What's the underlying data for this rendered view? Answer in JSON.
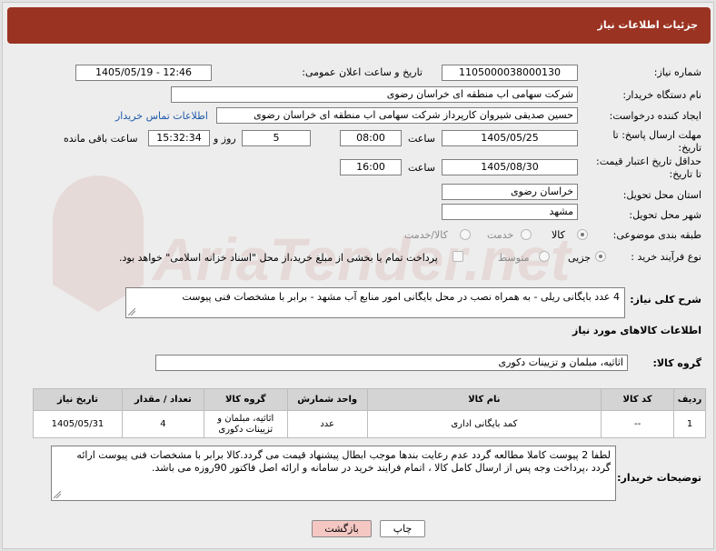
{
  "window": {
    "title": "جزئیات اطلاعات نیاز"
  },
  "form": {
    "need_number": {
      "label": "شماره نیاز:",
      "value": "1105000038000130"
    },
    "announce_datetime": {
      "label": "تاریخ و ساعت اعلان عمومی:",
      "value": "1405/05/19 - 12:46"
    },
    "buyer_org": {
      "label": "نام دستگاه خریدار:",
      "value": "شرکت سهامی اب منطقه ای خراسان رضوی"
    },
    "requester": {
      "label": "ایجاد کننده درخواست:",
      "value": "حسین صدیقی شیروان کارپرداز شرکت سهامی اب منطقه ای خراسان رضوی",
      "contact_link": "اطلاعات تماس خریدار"
    },
    "reply_deadline": {
      "label_line1": "مهلت ارسال پاسخ: تا",
      "label_line2": "تاریخ:",
      "date": "1405/05/25",
      "time_label": "ساعت",
      "time": "08:00",
      "days": "5",
      "days_label": "روز و",
      "remaining": "15:32:34",
      "remaining_label": "ساعت باقی مانده"
    },
    "price_validity": {
      "label_line1": "حداقل تاریخ اعتبار قیمت:",
      "label_line2": "تا تاریخ:",
      "date": "1405/08/30",
      "time_label": "ساعت",
      "time": "16:00"
    },
    "delivery_province": {
      "label": "استان محل تحویل:",
      "value": "خراسان رضوی"
    },
    "delivery_city": {
      "label": "شهر محل تحویل:",
      "value": "مشهد"
    },
    "category": {
      "label": "طبقه بندی موضوعی:",
      "options": [
        "کالا",
        "خدمت",
        "کالا/خدمت"
      ],
      "selected": "کالا"
    },
    "process_type": {
      "label": "نوع فرآیند خرید :",
      "options": [
        "جزیی",
        "متوسط"
      ],
      "selected": "جزیی",
      "payment_note": "پرداخت تمام یا بخشی از مبلغ خرید،از محل \"اسناد خزانه اسلامی\" خواهد بود."
    },
    "general_description": {
      "label": "شرح کلی نیاز:",
      "value": "4 عدد بایگانی ریلی - به همراه نصب در محل بایگانی امور منابع آب مشهد - برابر با مشخصات فنی پیوست"
    }
  },
  "goods_section": {
    "title": "اطلاعات کالاهای مورد نیاز",
    "group_label": "گروه کالا:",
    "group_value": "اثاثیه، مبلمان و تزیینات دکوری",
    "table": {
      "headers": [
        "ردیف",
        "کد کالا",
        "نام کالا",
        "واحد شمارش",
        "گروه کالا",
        "تعداد / مقدار",
        "تاریخ نیاز"
      ],
      "rows": [
        [
          "1",
          "--",
          "کمد بایگانی اداری",
          "عدد",
          "اثاثیه، مبلمان و تزیینات دکوری",
          "4",
          "1405/05/31"
        ]
      ]
    }
  },
  "buyer_notes": {
    "label": "توضیحات خریدار:",
    "value": "لطفا 2 پیوست کاملا مطالعه گردد عدم رعایت بندها موجب ابطال پیشنهاد قیمت می گردد.کالا برابر با مشخصات فنی پیوست ارائه گردد ،پرداخت وجه پس از ارسال کامل کالا ، اتمام فرایند خرید در سامانه و ارائه اصل فاکتور 90روزه می باشد."
  },
  "buttons": {
    "print": "چاپ",
    "back": "بازگشت"
  },
  "colors": {
    "title_bar": "#9b3322",
    "back_button": "#f4c7c3",
    "print_button": "#ffffff",
    "link": "#1e5aa8"
  },
  "watermark": {
    "brand_text": "AriaTender.net"
  }
}
